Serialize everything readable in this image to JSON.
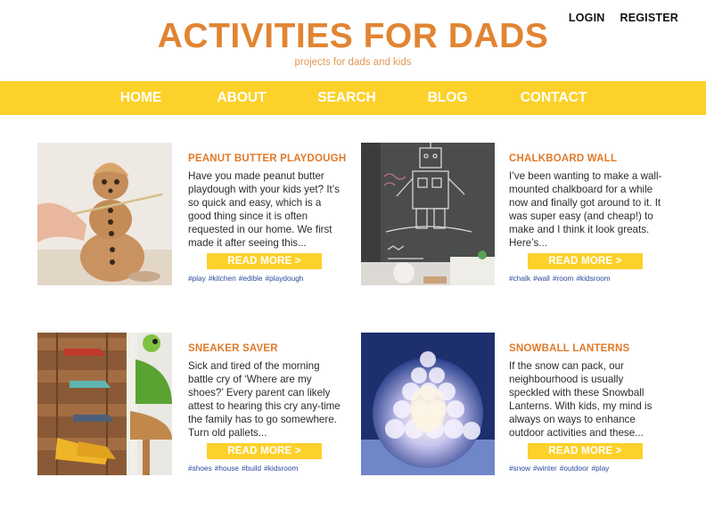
{
  "header": {
    "title": "ACTIVITIES FOR DADS",
    "tagline": "projects for dads and kids",
    "login": "LOGIN",
    "register": "REGISTER"
  },
  "nav": [
    "HOME",
    "ABOUT",
    "SEARCH",
    "BLOG",
    "CONTACT"
  ],
  "posts": [
    {
      "title": "PEANUT BUTTER PLAYDOUGH",
      "excerpt": "Have you made peanut butter playdough with your kids yet? It’s so quick and easy, which is a good thing since it is often requested in our home. We first made it after seeing this...",
      "more": "READ MORE >",
      "tags": [
        "#play",
        "#kitchen",
        "#edible",
        "#playdough"
      ],
      "image_icon": "peanut-butter-snowman-photo"
    },
    {
      "title": "CHALKBOARD WALL",
      "excerpt": "I’ve been wanting to make a wall-mounted chalkboard for a while now and finally got around to it. It was super easy (and cheap!) to make and I think it look greats. Here’s...",
      "more": "READ MORE >",
      "tags": [
        "#chalk",
        "#wall",
        "#room",
        "#kidsroom"
      ],
      "image_icon": "chalkboard-robot-photo"
    },
    {
      "title": "SNEAKER SAVER",
      "excerpt": "Sick and tired of the morning battle cry of ‘Where are my shoes?’ Every parent can likely attest to hearing this cry any-time the family has to go somewhere. Turn old pallets...",
      "more": "READ MORE >",
      "tags": [
        "#shoes",
        "#house",
        "#build",
        "#kidsroom"
      ],
      "image_icon": "pallet-shoe-rack-photo"
    },
    {
      "title": "SNOWBALL LANTERNS",
      "excerpt": "If the snow can pack, our neighbourhood is usually speckled with these Snowball Lanterns. With kids, my mind is always on ways to enhance outdoor activities and these...",
      "more": "READ MORE >",
      "tags": [
        "#snow",
        "#winter",
        "#outdoor",
        "#play"
      ],
      "image_icon": "snowball-lantern-photo"
    }
  ],
  "colors": {
    "accent_orange": "#e28432",
    "nav_yellow": "#fcd12a",
    "tag_blue": "#2b4aa0"
  }
}
